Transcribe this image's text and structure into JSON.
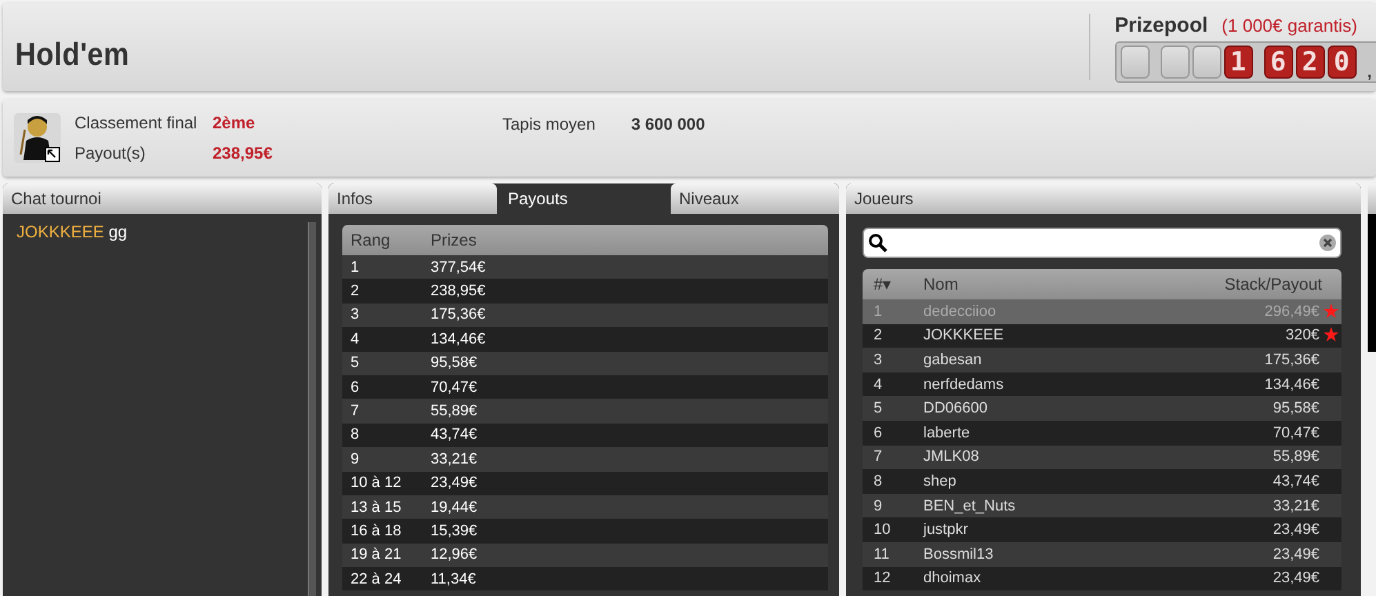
{
  "header": {
    "title": "Hold'em",
    "prizepool": {
      "label": "Prizepool",
      "note": "(1 000€ garantis)",
      "groups": [
        {
          "digits": [
            {
              "lit": false
            }
          ]
        },
        {
          "digits": [
            {
              "lit": false
            },
            {
              "lit": false
            },
            {
              "lit": true,
              "text": "1"
            }
          ]
        },
        {
          "digits": [
            {
              "lit": true,
              "text": "6"
            },
            {
              "lit": true,
              "text": "2"
            },
            {
              "lit": true,
              "text": "0"
            }
          ]
        }
      ],
      "separator": ","
    }
  },
  "summary": {
    "stats": [
      {
        "label": "Classement final",
        "value": "2ème"
      },
      {
        "label": "Payout(s)",
        "value": "238,95€"
      }
    ],
    "average_stack": {
      "label": "Tapis moyen",
      "value": "3 600 000"
    }
  },
  "chat": {
    "title": "Chat tournoi",
    "messages": [
      {
        "author": "JOKKKEEE",
        "text": "gg"
      }
    ]
  },
  "tabs": [
    {
      "label": "Infos",
      "selected": false
    },
    {
      "label": "Payouts",
      "selected": true
    },
    {
      "label": "Niveaux",
      "selected": false
    }
  ],
  "payouts": {
    "columns": [
      "Rang",
      "Prizes"
    ],
    "rows": [
      [
        "1",
        "377,54€"
      ],
      [
        "2",
        "238,95€"
      ],
      [
        "3",
        "175,36€"
      ],
      [
        "4",
        "134,46€"
      ],
      [
        "5",
        "95,58€"
      ],
      [
        "6",
        "70,47€"
      ],
      [
        "7",
        "55,89€"
      ],
      [
        "8",
        "43,74€"
      ],
      [
        "9",
        "33,21€"
      ],
      [
        "10 à 12",
        "23,49€"
      ],
      [
        "13 à 15",
        "19,44€"
      ],
      [
        "16 à 18",
        "15,39€"
      ],
      [
        "19 à 21",
        "12,96€"
      ],
      [
        "22 à 24",
        "11,34€"
      ]
    ]
  },
  "players": {
    "title": "Joueurs",
    "columns": [
      "#▾",
      "Nom",
      "Stack/Payout"
    ],
    "rows": [
      {
        "rank": "1",
        "name": "dedecciioo",
        "amount": "296,49€",
        "starred": true,
        "selected": true
      },
      {
        "rank": "2",
        "name": "JOKKKEEE",
        "amount": "320€",
        "starred": true,
        "selected": false
      },
      {
        "rank": "3",
        "name": "gabesan",
        "amount": "175,36€",
        "starred": false,
        "selected": false
      },
      {
        "rank": "4",
        "name": "nerfdedams",
        "amount": "134,46€",
        "starred": false,
        "selected": false
      },
      {
        "rank": "5",
        "name": "DD06600",
        "amount": "95,58€",
        "starred": false,
        "selected": false
      },
      {
        "rank": "6",
        "name": "laberte",
        "amount": "70,47€",
        "starred": false,
        "selected": false
      },
      {
        "rank": "7",
        "name": "JMLK08",
        "amount": "55,89€",
        "starred": false,
        "selected": false
      },
      {
        "rank": "8",
        "name": "shep",
        "amount": "43,74€",
        "starred": false,
        "selected": false
      },
      {
        "rank": "9",
        "name": "BEN_et_Nuts",
        "amount": "33,21€",
        "starred": false,
        "selected": false
      },
      {
        "rank": "10",
        "name": "justpkr",
        "amount": "23,49€",
        "starred": false,
        "selected": false
      },
      {
        "rank": "11",
        "name": "Bossmil13",
        "amount": "23,49€",
        "starred": false,
        "selected": false
      },
      {
        "rank": "12",
        "name": "dhoimax",
        "amount": "23,49€",
        "starred": false,
        "selected": false
      }
    ]
  }
}
